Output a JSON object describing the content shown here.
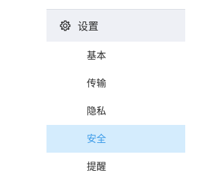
{
  "settings_menu": {
    "title": "设置",
    "title_icon": "gear-icon",
    "items": [
      {
        "label": "基本",
        "active": false
      },
      {
        "label": "传输",
        "active": false
      },
      {
        "label": "隐私",
        "active": false
      },
      {
        "label": "安全",
        "active": true
      },
      {
        "label": "提醒",
        "active": false
      }
    ]
  },
  "colors": {
    "header_bg": "#eef0f5",
    "active_bg": "#d4ecfd",
    "active_text": "#3a9ae8",
    "text": "#2b2b2b"
  }
}
